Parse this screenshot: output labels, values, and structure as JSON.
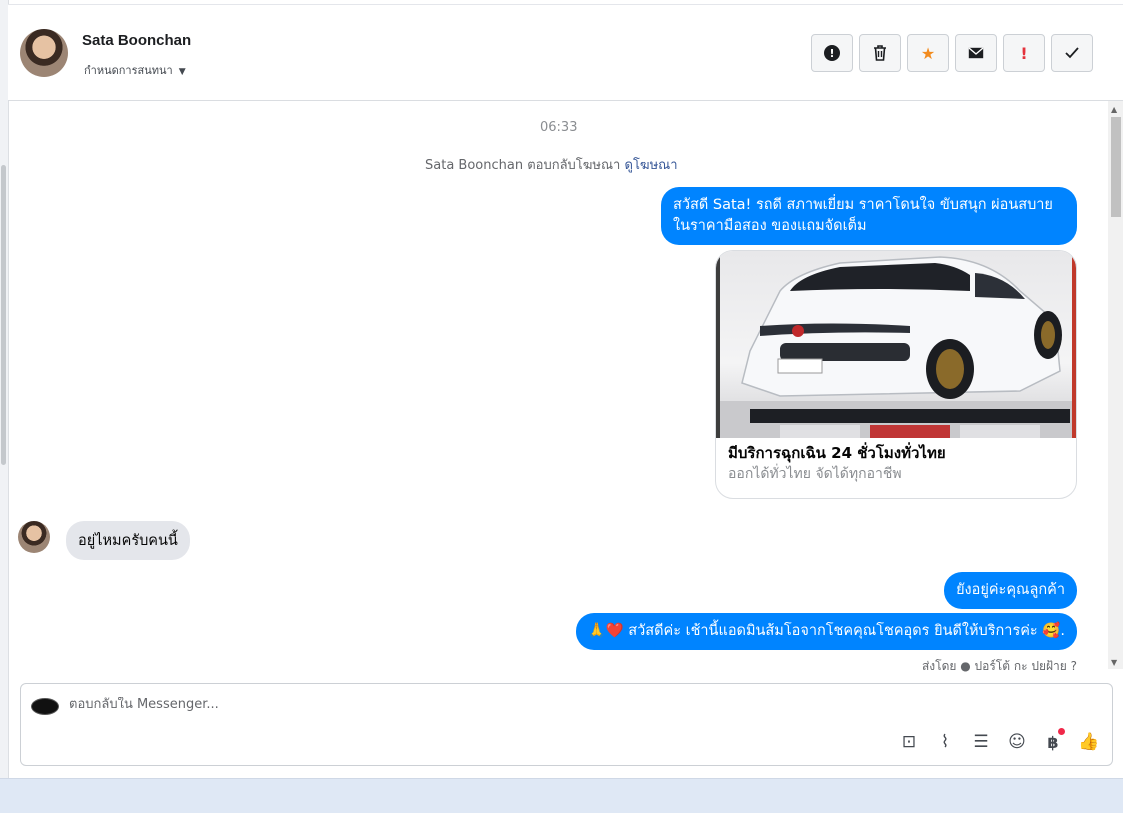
{
  "header": {
    "contact_name": "Sata Boonchan",
    "assign_label": "กำหนดการสนทนา",
    "actions": [
      {
        "name": "mark-spam-button",
        "icon": "exclamation-circle-icon"
      },
      {
        "name": "delete-button",
        "icon": "trash-icon"
      },
      {
        "name": "star-button",
        "icon": "star-icon"
      },
      {
        "name": "mark-unread-button",
        "icon": "envelope-icon"
      },
      {
        "name": "follow-up-button",
        "icon": "exclamation-icon"
      },
      {
        "name": "mark-done-button",
        "icon": "checkmark-icon"
      }
    ]
  },
  "thread": {
    "timestamp": "06:33",
    "ad_note": {
      "text": "Sata Boonchan ตอบกลับโฆษณา",
      "link": "ดูโฆษณา"
    },
    "msg_greeting": "สวัสดี Sata! รถดี สภาพเยี่ยม ราคาโดนใจ ขับสนุก ผ่อนสบาย ในราคามือสอง ของแถมจัดเต็ม",
    "ad_card": {
      "title": "มีบริการฉุกเฉิน 24 ชั่วโมงทั่วไทย",
      "subtitle": "ออกได้ทั่วไทย จัดได้ทุกอาชีพ"
    },
    "msg_incoming": "อยู่ไหมครับคนนี้",
    "msg_reply_1": "ยังอยู่ค่ะคุณลูกค้า",
    "msg_reply_2": "🙏❤️ สวัสดีค่ะ เช้านี้แอดมินส้มโอจากโชคคุณโชคอุดร ยินดีให้บริการค่ะ 🥰.",
    "sent_by": "ส่งโดย ● ปอร์โต้ กะ ปยฝ้าย"
  },
  "composer": {
    "placeholder": "ตอบกลับใน Messenger...",
    "tools": [
      "saved-reply-icon",
      "attachment-icon",
      "chat-bubbles-icon",
      "emoji-icon",
      "baht-payment-icon",
      "like-icon"
    ]
  },
  "colors": {
    "outgoing_bubble": "#0084ff",
    "incoming_bubble": "#e4e6eb",
    "star": "#f28b1e",
    "alert": "#e4323c"
  }
}
